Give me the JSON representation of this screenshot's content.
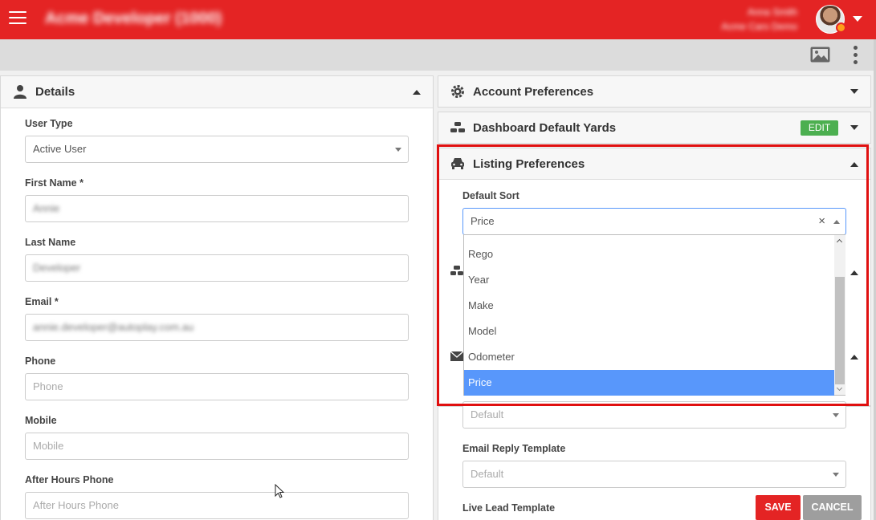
{
  "app": {
    "title": "Acme Developer (1000)"
  },
  "user": {
    "name": "Anna Smith",
    "company": "Acme Cars Demo"
  },
  "left_panel": {
    "title": "Details",
    "fields": {
      "user_type": {
        "label": "User Type",
        "value": "Active User"
      },
      "first_name": {
        "label": "First Name *",
        "value": "Annie"
      },
      "last_name": {
        "label": "Last Name",
        "value": "Developer"
      },
      "email": {
        "label": "Email *",
        "value": "annie.developer@autoplay.com.au"
      },
      "phone": {
        "label": "Phone",
        "placeholder": "Phone"
      },
      "mobile": {
        "label": "Mobile",
        "placeholder": "Mobile"
      },
      "after_hours": {
        "label": "After Hours Phone",
        "placeholder": "After Hours Phone"
      }
    }
  },
  "right_panels": {
    "account": {
      "title": "Account Preferences"
    },
    "dashboard": {
      "title": "Dashboard Default Yards",
      "edit_label": "EDIT"
    },
    "listing": {
      "title": "Listing Preferences",
      "default_sort": {
        "label": "Default Sort",
        "value": "Price",
        "clear_symbol": "×",
        "options": [
          "Rego",
          "Year",
          "Make",
          "Model",
          "Odometer",
          "Price"
        ],
        "selected": "Price"
      }
    },
    "email": {
      "default_placeholder": "Default",
      "reply_template": {
        "label": "Email Reply Template",
        "placeholder": "Default"
      },
      "live_lead_label": "Live Lead Template"
    }
  },
  "actions": {
    "save": "SAVE",
    "cancel": "CANCEL"
  },
  "colors": {
    "brand": "#e42424",
    "edit": "#4caf50",
    "selected": "#5897fb",
    "cancel": "#9e9e9e"
  }
}
